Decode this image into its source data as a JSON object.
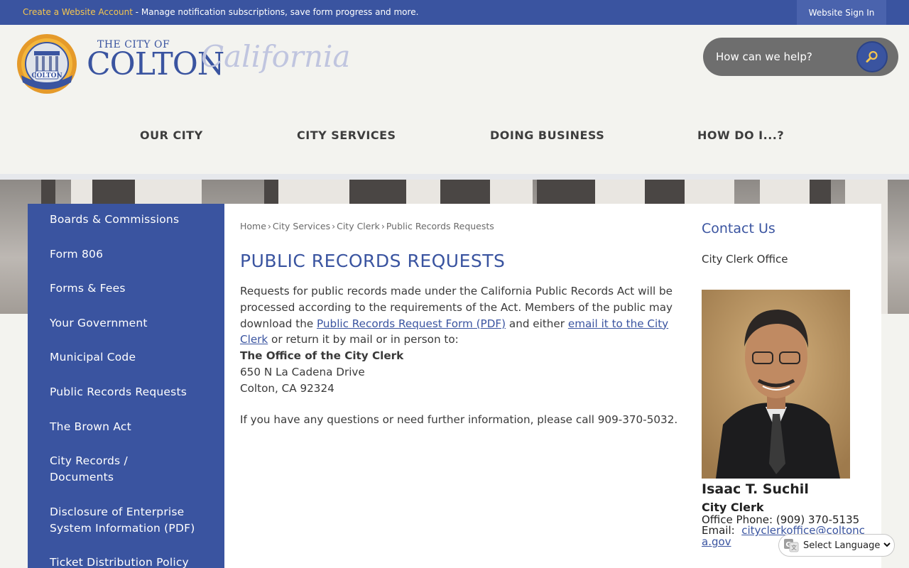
{
  "topbar": {
    "create_link": "Create a Website Account",
    "message": " - Manage notification subscriptions, save form progress and more.",
    "signin": "Website Sign In"
  },
  "logo": {
    "small": "THE CITY OF",
    "big": "COLTON",
    "script": "California",
    "seal_text": "COLTON"
  },
  "search": {
    "placeholder": "How can we help?",
    "icon": "search-icon"
  },
  "nav": [
    "OUR CITY",
    "CITY SERVICES",
    "DOING BUSINESS",
    "HOW DO I...?"
  ],
  "sidebar": {
    "items": [
      "Boards & Commissions",
      "Form 806",
      "Forms & Fees",
      "Your Government",
      "Municipal Code",
      "Public Records Requests",
      "The Brown Act",
      "City Records / Documents",
      "Disclosure of Enterprise System Information (PDF)",
      "Ticket Distribution Policy"
    ]
  },
  "breadcrumb": [
    "Home",
    "City Services",
    "City Clerk",
    "Public Records Requests"
  ],
  "page": {
    "title": "PUBLIC RECORDS REQUESTS",
    "intro": "Requests for public records made under the California Public Records Act will be processed according to the requirements of the Act. Members of the public may download the ",
    "link1": "Public Records Request Form (PDF)",
    "mid": " and either ",
    "link2": "email it to the City Clerk",
    "end": " or return it by mail or in person to:",
    "office": "The Office of the City Clerk",
    "address1": "650 N La Cadena Drive",
    "address2": "Colton, CA 92324",
    "questions": "If you have any questions or need further information, please call 909-370-5032."
  },
  "contact": {
    "heading": "Contact Us",
    "office": "City Clerk Office",
    "name": "Isaac T. Suchil",
    "role": "City Clerk",
    "phone": "Office Phone: (909) 370-5135",
    "email_label": "Email:",
    "email": "cityclerkoffice@coltonca.gov"
  },
  "language": {
    "label": "Select Language"
  },
  "colors": {
    "brand": "#3a54a0",
    "accent": "#f5c64e",
    "background": "#f3f3ef"
  }
}
